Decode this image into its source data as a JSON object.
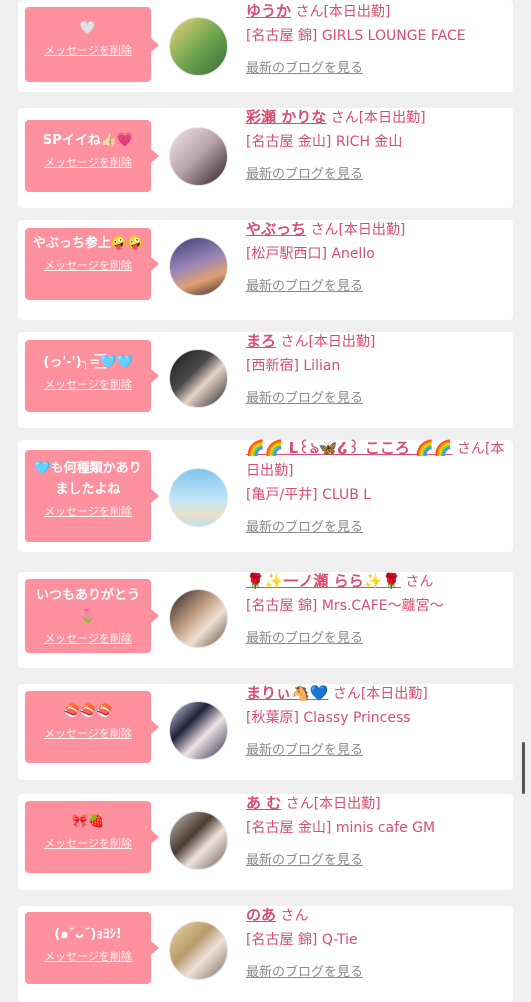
{
  "delete_label": "メッセージを削除",
  "san_label": "さん",
  "blog_label": "最新のブログを見る",
  "colors": {
    "accent": "#ff909d",
    "name": "#d94d6f",
    "background": "#efefef"
  },
  "entries": [
    {
      "message": "🤍",
      "name": "ゆうか",
      "status": "[本日出勤]",
      "shop": "[名古屋 錦] GIRLS LOUNGE FACE",
      "avatar": "avatar-photo"
    },
    {
      "message": "SPイイね👍🏻💗",
      "name": "彩瀬 かりな",
      "status": "[本日出勤]",
      "shop": "[名古屋 金山] RICH 金山",
      "avatar": "avatar-photo"
    },
    {
      "message": "やぶっち参上🤪🤪",
      "name": "やぶっち",
      "status": "[本日出勤]",
      "shop": "[松戸駅西口] Anello",
      "avatar": "avatar-photo"
    },
    {
      "message": "(っ'-')╮=͟͟͞͞🩵🩵",
      "name": "まろ",
      "status": "[本日出勤]",
      "shop": "[西新宿] Lilian",
      "avatar": "avatar-photo"
    },
    {
      "message": "🩵も何種類かありましたよね",
      "name": "🌈🌈 L꒰ঌ🦋໒꒱ こころ 🌈🌈",
      "status": "[本日出勤]",
      "shop": "[亀戸/平井] CLUB L",
      "avatar": "avatar-photo"
    },
    {
      "message": "いつもありがとう🌷",
      "name": "🌹✨一ノ瀬 らら✨🌹",
      "status": "",
      "shop": "[名古屋 錦] Mrs.CAFE〜離宮〜",
      "avatar": "avatar-photo"
    },
    {
      "message": "🍣🍣🍣",
      "name": "まりぃ🐴💙",
      "status": "[本日出勤]",
      "shop": "[秋葉原] Classy Princess",
      "avatar": "avatar-photo"
    },
    {
      "message": "🎀🍓",
      "name": "あ む",
      "status": "[本日出勤]",
      "shop": "[名古屋 金山] minis cafe GM",
      "avatar": "avatar-photo"
    },
    {
      "message": "(๑˘ᴗ˘)ｮﾖｼ!",
      "name": "のあ",
      "status": "",
      "shop": "[名古屋 錦] Q-Tie",
      "avatar": "avatar-photo"
    }
  ]
}
